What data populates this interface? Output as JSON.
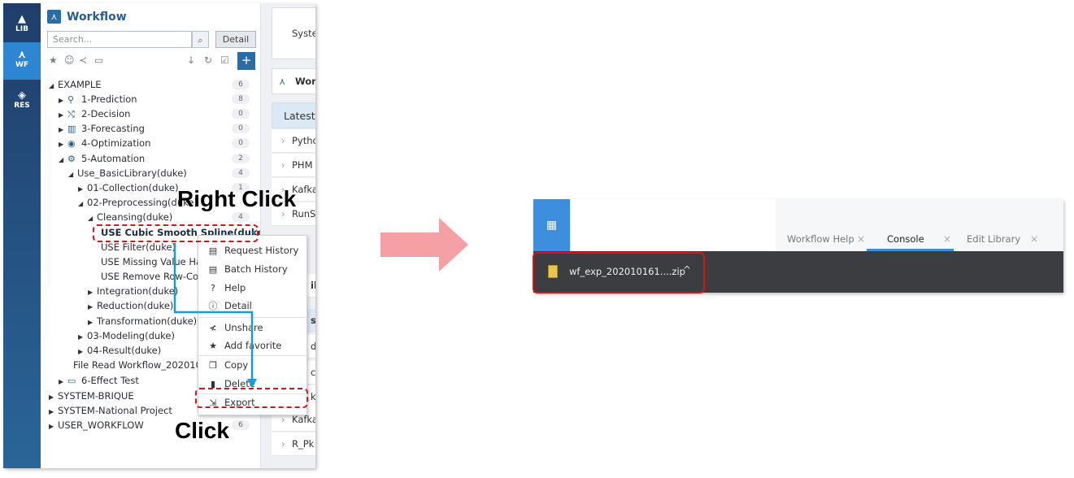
{
  "rail": [
    {
      "label": "LIB",
      "icon": "library-icon"
    },
    {
      "label": "WF",
      "icon": "workflow-icon",
      "active": true
    },
    {
      "label": "RES",
      "icon": "layers-icon"
    }
  ],
  "workflow": {
    "title": "Workflow",
    "search_placeholder": "Search...",
    "detail_label": "Detail",
    "add_label": "+",
    "tree": [
      {
        "label": "EXAMPLE",
        "count": "6"
      },
      {
        "label": "1-Prediction",
        "count": "8"
      },
      {
        "label": "2-Decision",
        "count": "0"
      },
      {
        "label": "3-Forecasting",
        "count": "0"
      },
      {
        "label": "4-Optimization",
        "count": "0"
      },
      {
        "label": "5-Automation",
        "count": "2"
      },
      {
        "label": "Use_BasicLibrary(duke)",
        "count": "4"
      },
      {
        "label": "01-Collection(duke)",
        "count": "1"
      },
      {
        "label": "02-Preprocessing(duke)",
        "count": ""
      },
      {
        "label": "Cleansing(duke)",
        "count": "4"
      },
      {
        "label": "USE Cubic Smooth Spline(duke)",
        "count": ""
      },
      {
        "label": "USE Filter(duke)",
        "count": ""
      },
      {
        "label": "USE Missing Value Han",
        "count": ""
      },
      {
        "label": "USE Remove Row-Colu",
        "count": ""
      },
      {
        "label": "Integration(duke)",
        "count": ""
      },
      {
        "label": "Reduction(duke)",
        "count": ""
      },
      {
        "label": "Transformation(duke)",
        "count": ""
      },
      {
        "label": "03-Modeling(duke)",
        "count": ""
      },
      {
        "label": "04-Result(duke)",
        "count": ""
      },
      {
        "label": "File Read Workflow_2020101",
        "count": ""
      },
      {
        "label": "6-Effect Test",
        "count": ""
      },
      {
        "label": "SYSTEM-BRIQUE",
        "count": ""
      },
      {
        "label": "SYSTEM-National Project",
        "count": ""
      },
      {
        "label": "USER_WORKFLOW",
        "count": "6"
      }
    ]
  },
  "strip": {
    "card_label": "Syste",
    "header_label": "Wor",
    "latest_label": "Latest",
    "rows": [
      "Pytho",
      "PHM",
      "Kafka",
      "RunS"
    ],
    "partial_a": "ib",
    "partial_b": "st",
    "rows2": [
      "de",
      "ch",
      "ka",
      "Kafka",
      "R_Pk"
    ]
  },
  "context_menu": {
    "items": [
      "Request History",
      "Batch History",
      "Help",
      "Detail",
      "Unshare",
      "Add favorite",
      "Copy",
      "Delete",
      "Export"
    ]
  },
  "callouts": {
    "right_click": "Right Click",
    "click": "Click"
  },
  "right_panel": {
    "tabs": [
      "Workflow Help",
      "Console",
      "Edit Library"
    ],
    "close_glyph": "×",
    "download": {
      "file_name": "wf_exp_202010161....zip"
    }
  },
  "colors": {
    "accent": "#2a6ca5",
    "highlight": "#d9141b",
    "connector": "#1b9ad6",
    "arrow": "#f4a0a4"
  }
}
